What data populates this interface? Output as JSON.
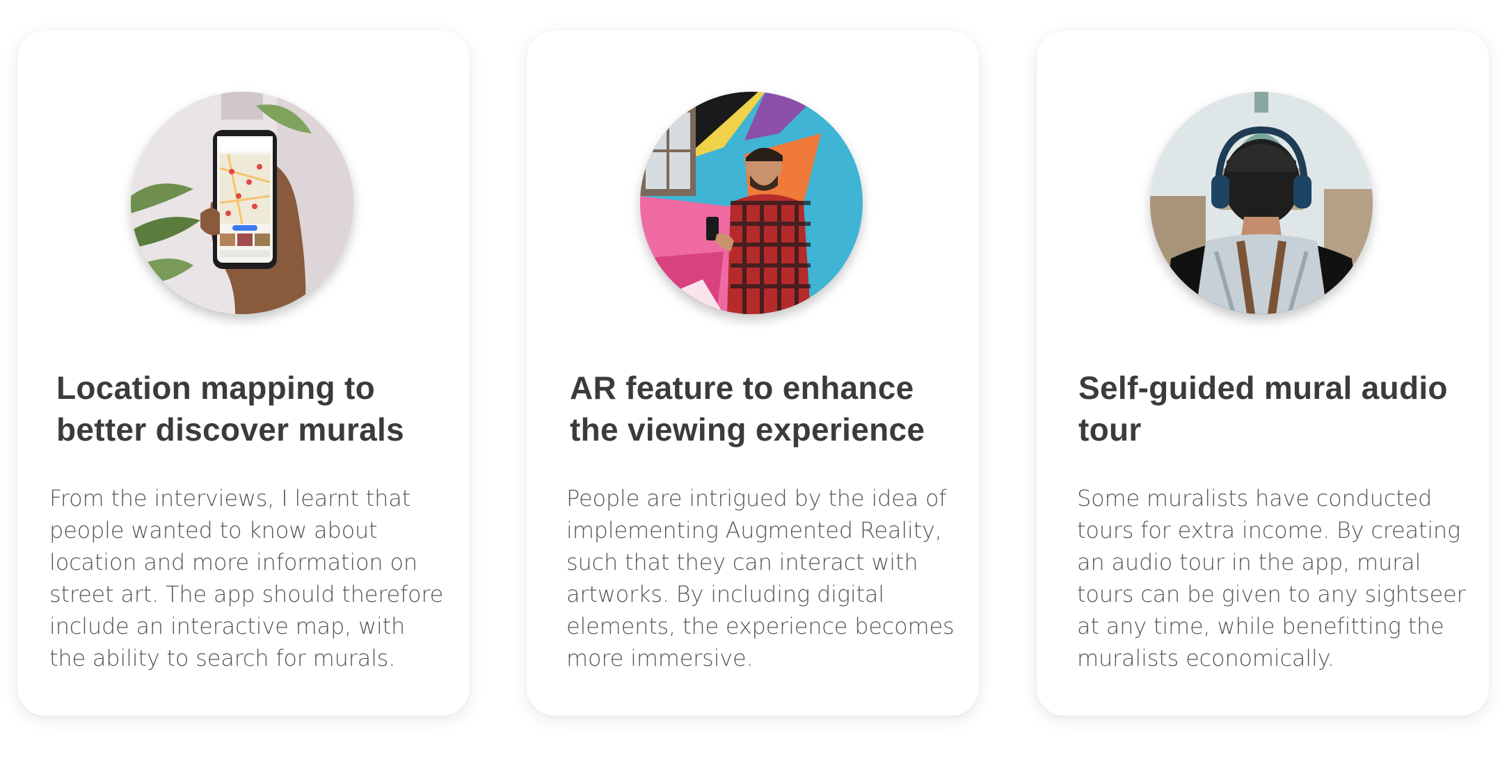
{
  "cards": [
    {
      "image_icon": "phone-map-photo-icon",
      "title": "Location mapping to better discover murals",
      "body": "From the interviews, I learnt that people wanted to know about location and more information on street art. The app should therefore include an interactive map, with the ability to search for murals."
    },
    {
      "image_icon": "ar-mural-photo-icon",
      "title": "AR feature to enhance the viewing experience",
      "body": "People are intrigued by the idea of implementing Augmented Reality, such that they can interact with artworks. By including digital elements, the experience becomes more immersive."
    },
    {
      "image_icon": "audio-tour-photo-icon",
      "title": "Self-guided mural audio tour",
      "body": "Some muralists have conducted tours for extra income. By creating an audio tour in the app, mural tours can be given to any sightseer at any time, while benefitting the muralists economically."
    }
  ],
  "colors": {
    "title": "#3b3b3b",
    "body": "#555555",
    "card_bg": "#ffffff"
  }
}
